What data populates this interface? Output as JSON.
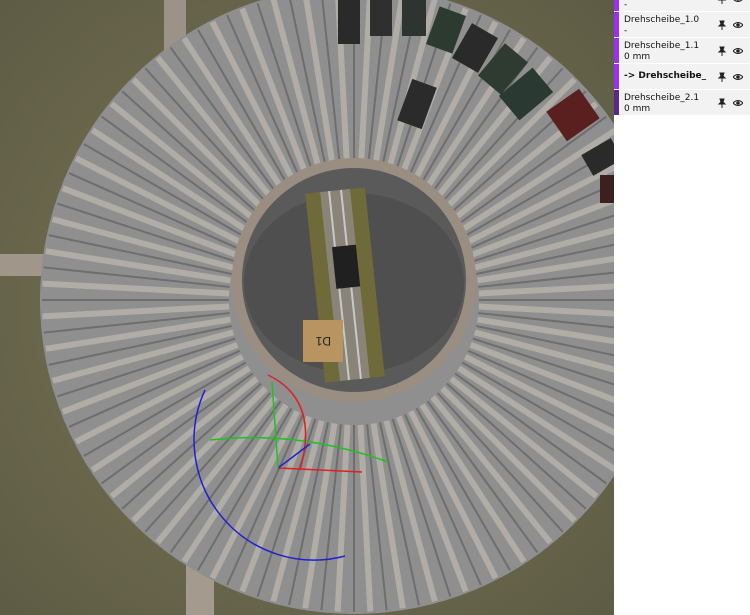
{
  "layers_panel": {
    "rows": [
      {
        "name": "",
        "sub": "-",
        "bar_color": "#9b30f0",
        "partial": true
      },
      {
        "name": "Drehscheibe_1.0",
        "sub": "-",
        "bar_color": "#9b30f0"
      },
      {
        "name": "Drehscheibe_1.1",
        "sub": "0 mm",
        "bar_color": "#9b30f0"
      },
      {
        "name": "-> Drehscheibe_",
        "sub": "",
        "bar_color": "#9b30f0",
        "active": true
      },
      {
        "name": "Drehscheibe_2.1",
        "sub": "0 mm",
        "bar_color": "#5a2a8a"
      }
    ]
  },
  "scene": {
    "turntable_label": "D1",
    "icons": {
      "pin": "pin-icon",
      "visibility": "eye-icon"
    },
    "gizmo_colors": {
      "x_axis": "#e02020",
      "y_axis": "#20c020",
      "z_axis": "#2020d0"
    }
  }
}
